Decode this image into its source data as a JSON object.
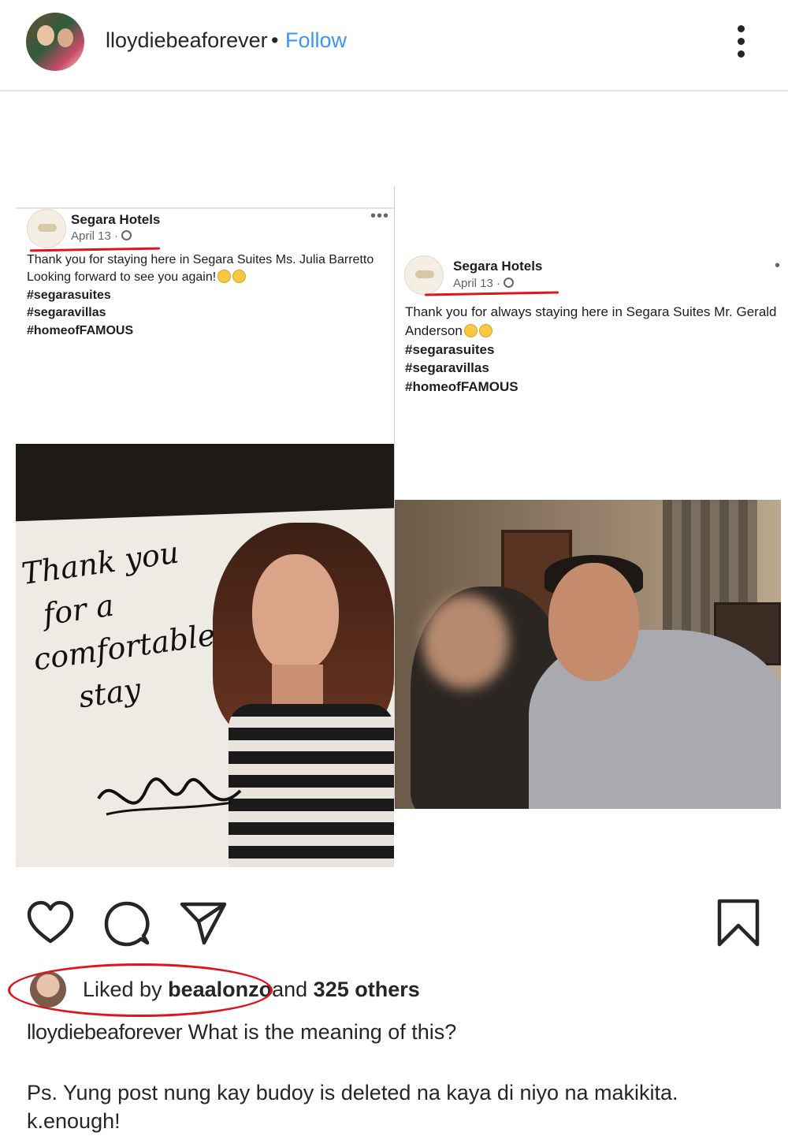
{
  "header": {
    "username": "lloydiebeaforever",
    "separator": "•",
    "follow_label": "Follow"
  },
  "post": {
    "left_card": {
      "page_name": "Segara Hotels",
      "date": "April 13 ·",
      "more": "•••",
      "caption": "Thank you for staying here in Segara Suites Ms. Julia Barretto Looking forward to see you again!",
      "hashtags": [
        "#segarasuites",
        "#segaravillas",
        "#homeofFAMOUS"
      ],
      "handwriting": [
        "Thank you",
        "for a",
        "comfortable",
        "stay"
      ]
    },
    "right_card": {
      "page_name": "Segara Hotels",
      "date": "April 13 ·",
      "more": "•",
      "caption": "Thank you for always staying here in Segara Suites Mr. Gerald Anderson",
      "hashtags": [
        "#segarasuites",
        "#segaravillas",
        "#homeofFAMOUS"
      ]
    }
  },
  "actions": {
    "like": "heart-icon",
    "comment": "comment-icon",
    "share": "share-icon",
    "save": "bookmark-icon"
  },
  "likes": {
    "prefix": "Liked by ",
    "user": "beaalonzo",
    "middle": "and ",
    "others": "325 others"
  },
  "caption": {
    "username": "lloydiebeaforever",
    "text": " What is the meaning of this? ",
    "glyph": "",
    "ps_line1": "Ps. Yung post nung kay budoy is deleted na kaya di niyo na makikita.",
    "ps_line2": "k.enough!"
  },
  "colors": {
    "follow": "#3897f0",
    "annotation_red": "#e0141e"
  }
}
